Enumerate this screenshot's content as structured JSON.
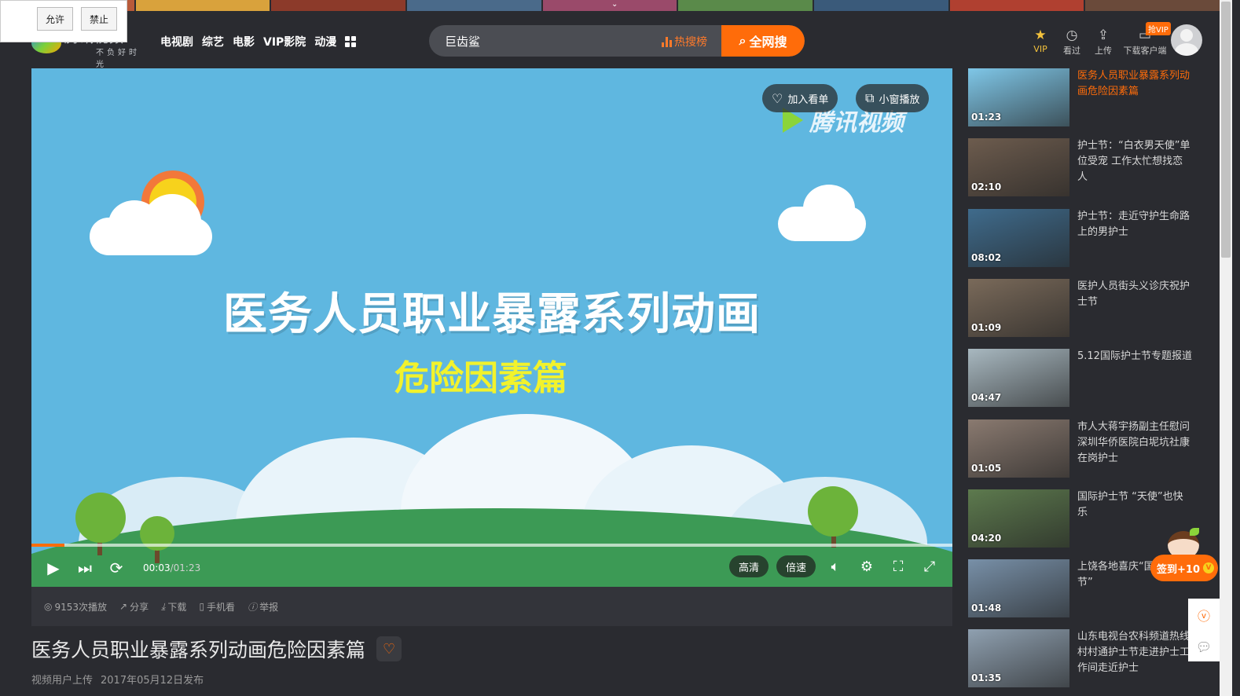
{
  "permission": {
    "allow": "允许",
    "deny": "禁止"
  },
  "brand": {
    "logo_text": "腾讯视频",
    "slogan": "不负好时光"
  },
  "nav": {
    "items": [
      "电视剧",
      "综艺",
      "电影",
      "VIP影院",
      "动漫"
    ]
  },
  "search": {
    "value": "巨齿鲨",
    "hot_label": "热搜榜",
    "button_label": "全网搜"
  },
  "header_icons": {
    "vip": "VIP",
    "history": "看过",
    "upload": "上传",
    "download": "下载客户端",
    "vip_badge": "抢VIP"
  },
  "player": {
    "title_line1": "医务人员职业暴露系列动画",
    "title_line2": "危险因素篇",
    "watermark": "腾讯视频",
    "add_watchlist": "加入看单",
    "mini_play": "小窗播放",
    "current_time": "00:03",
    "total_time": "/01:23",
    "progress_fraction": 0.036,
    "quality": "高清",
    "speed": "倍速"
  },
  "action_bar": {
    "plays": "9153次播放",
    "share": "分享",
    "download": "下载",
    "mobile": "手机看",
    "report": "举报"
  },
  "video": {
    "title": "医务人员职业暴露系列动画危险因素篇",
    "uploader": "视频用户上传",
    "date": "2017年05月12日发布"
  },
  "related": [
    {
      "title": "医务人员职业暴露系列动画危险因素篇",
      "duration": "01:23",
      "active": true,
      "color": "#7fc7e8"
    },
    {
      "title": "护士节：“白衣男天使”单位受宠 工作太忙想找恋人",
      "duration": "02:10",
      "active": false,
      "color": "#6d5c4e"
    },
    {
      "title": "护士节：走近守护生命路上的男护士",
      "duration": "08:02",
      "active": false,
      "color": "#3f6b8c"
    },
    {
      "title": "医护人员街头义诊庆祝护士节",
      "duration": "01:09",
      "active": false,
      "color": "#7a6a5a"
    },
    {
      "title": "5.12国际护士节专题报道",
      "duration": "04:47",
      "active": false,
      "color": "#a8b8c0"
    },
    {
      "title": "市人大蒋宇扬副主任慰问深圳华侨医院白坭坑社康在岗护士",
      "duration": "01:05",
      "active": false,
      "color": "#8a7a70"
    },
    {
      "title": "国际护士节 “天使”也快乐",
      "duration": "04:20",
      "active": false,
      "color": "#5d7a4e"
    },
    {
      "title": "上饶各地喜庆“国际护士节”",
      "duration": "01:48",
      "active": false,
      "color": "#7890a8"
    },
    {
      "title": "山东电视台农科频道热线村村通护士节走进护士工作间走近护士",
      "duration": "01:35",
      "active": false,
      "color": "#8fa0b0"
    }
  ],
  "signin": {
    "label": "签到+10"
  },
  "colors": {
    "accent": "#ff6c0a",
    "sky": "#5fb7e0",
    "background": "#2a2b30"
  }
}
